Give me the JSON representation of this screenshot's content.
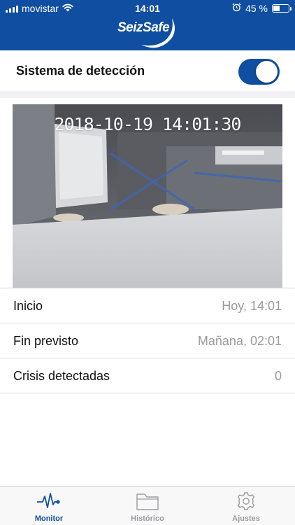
{
  "status_bar": {
    "carrier": "movistar",
    "time": "14:01",
    "battery_text": "45 %",
    "battery_level": 0.45
  },
  "header": {
    "logo_text": "SeizSafe"
  },
  "detection": {
    "label": "Sistema de detección",
    "enabled": true
  },
  "camera": {
    "timestamp": "2018-10-19  14:01:30"
  },
  "info": [
    {
      "label": "Inicio",
      "value": "Hoy, 14:01"
    },
    {
      "label": "Fin previsto",
      "value": "Mañana, 02:01"
    },
    {
      "label": "Crisis detectadas",
      "value": "0"
    }
  ],
  "tabs": [
    {
      "label": "Monitor",
      "icon": "heartbeat-icon",
      "active": true
    },
    {
      "label": "Histórico",
      "icon": "folder-icon",
      "active": false
    },
    {
      "label": "Ajustes",
      "icon": "gear-icon",
      "active": false
    }
  ],
  "colors": {
    "brand": "#0f4ea0",
    "tab_active": "#0f4ea0",
    "tab_inactive": "#9b9b9f"
  }
}
